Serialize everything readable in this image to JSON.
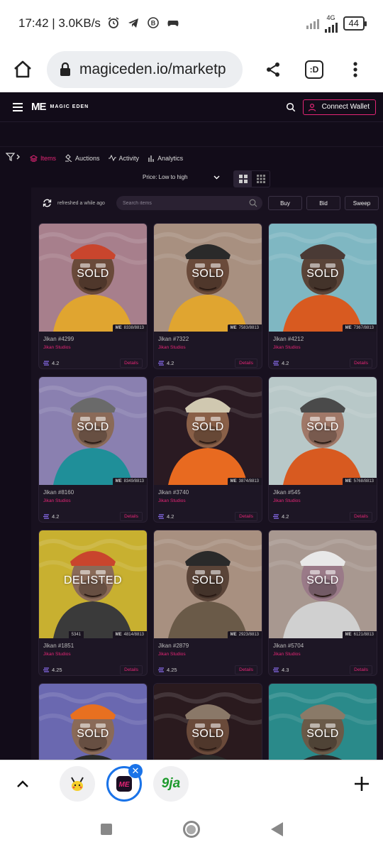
{
  "status_bar": {
    "time_speed": "17:42 | 3.0KB/s",
    "network": "4G",
    "battery": "44",
    "icons": [
      "alarm-icon",
      "telegram-icon",
      "b-circle-icon",
      "game-controller-icon"
    ]
  },
  "browser": {
    "url": "magiceden.io/marketp",
    "tabs_label": ":D"
  },
  "site": {
    "logo_text": "MAGIC EDEN",
    "connect_wallet": "Connect Wallet",
    "tabs": [
      {
        "label": "Items",
        "active": true
      },
      {
        "label": "Auctions",
        "active": false
      },
      {
        "label": "Activity",
        "active": false
      },
      {
        "label": "Analytics",
        "active": false
      }
    ],
    "sort_label": "Price: Low to high",
    "refreshed": "refreshed a while ago",
    "search_placeholder": "Search items",
    "buy": "Buy",
    "bid": "Bid",
    "sweep": "Sweep",
    "accent": "#e42575"
  },
  "cards": [
    {
      "name": "Jikan #4299",
      "collection": "Jikan Studios",
      "rank": "8338/8813",
      "price": "4.2",
      "status": "SOLD",
      "details": "Details",
      "bg": "#a77f8c",
      "skin": "#6a4a3a",
      "hat": "#c9452d",
      "shirt": "#e0a530"
    },
    {
      "name": "Jikan #7322",
      "collection": "Jikan Studios",
      "rank": "7583/8813",
      "price": "4.2",
      "status": "SOLD",
      "details": "Details",
      "bg": "#a89080",
      "skin": "#6a4a3a",
      "hat": "#2a2a2a",
      "shirt": "#e0a530"
    },
    {
      "name": "Jikan #4212",
      "collection": "Jikan Studios",
      "rank": "7367/8813",
      "price": "4.2",
      "status": "SOLD",
      "details": "Details",
      "bg": "#7fb7c2",
      "skin": "#5a4438",
      "hat": "#4a3a35",
      "shirt": "#d85a20"
    },
    {
      "name": "Jikan #8160",
      "collection": "Jikan Studios",
      "rank": "8349/8813",
      "price": "4.2",
      "status": "SOLD",
      "details": "Details",
      "bg": "#8a80b0",
      "skin": "#8a6a58",
      "hat": "#6a6a6a",
      "shirt": "#1f8f99"
    },
    {
      "name": "Jikan #3740",
      "collection": "Jikan Studios",
      "rank": "3874/8813",
      "price": "4.2",
      "status": "SOLD",
      "details": "Details",
      "bg": "#2a1a22",
      "skin": "#8a6048",
      "hat": "#d0c8b0",
      "shirt": "#e86a20"
    },
    {
      "name": "Jikan #545",
      "collection": "Jikan Studios",
      "rank": "5768/8813",
      "price": "4.2",
      "status": "SOLD",
      "details": "Details",
      "bg": "#b8c8c8",
      "skin": "#a07868",
      "hat": "#4a4a4a",
      "shirt": "#d85a20"
    },
    {
      "name": "Jikan #1851",
      "collection": "Jikan Studios",
      "rank": "4814/8813",
      "rank2": "5341",
      "price": "4.25",
      "status": "DELISTED",
      "details": "Details",
      "bg": "#c8b030",
      "skin": "#8a6a58",
      "hat": "#c9452d",
      "shirt": "#3a3a3a"
    },
    {
      "name": "Jikan #2879",
      "collection": "Jikan Studios",
      "rank": "2923/8813",
      "price": "4.25",
      "status": "SOLD",
      "details": "Details",
      "bg": "#a89080",
      "skin": "#5a4438",
      "hat": "#2a2a2a",
      "shirt": "#6a5a48"
    },
    {
      "name": "Jikan #5704",
      "collection": "Jikan Studios",
      "rank": "6121/8813",
      "price": "4.3",
      "status": "SOLD",
      "details": "Details",
      "bg": "#a89890",
      "skin": "#9a7a88",
      "hat": "#e8e8e8",
      "shirt": "#d0d0d0"
    },
    {
      "name": "",
      "collection": "",
      "rank": "",
      "price": "",
      "status": "SOLD",
      "details": "",
      "bg": "#6a68b0",
      "skin": "#8a6a58",
      "hat": "#e87020",
      "shirt": "#2a2a2a"
    },
    {
      "name": "",
      "collection": "",
      "rank": "",
      "price": "",
      "status": "SOLD",
      "details": "",
      "bg": "#2a1a1e",
      "skin": "#6a4a3a",
      "hat": "#8a7868",
      "shirt": "#2a2a2a"
    },
    {
      "name": "",
      "collection": "",
      "rank": "",
      "price": "",
      "status": "SOLD",
      "details": "",
      "bg": "#2a8a8a",
      "skin": "#6a5a48",
      "hat": "#8a7a68",
      "shirt": "#2a2a2a"
    }
  ],
  "bottom_tabs": [
    {
      "icon": "pikachu-icon",
      "active": false
    },
    {
      "icon": "magic-eden-icon",
      "active": true
    },
    {
      "icon": "9ja-icon",
      "label": "9ja",
      "active": false
    }
  ]
}
